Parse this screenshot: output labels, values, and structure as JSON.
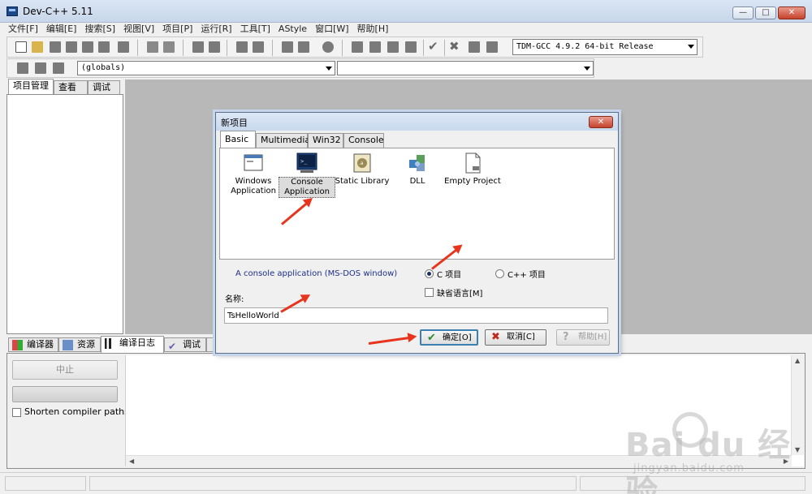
{
  "window": {
    "title": "Dev-C++ 5.11",
    "min_glyph": "—",
    "max_glyph": "□",
    "close_glyph": "✕"
  },
  "menu": [
    "文件[F]",
    "编辑[E]",
    "搜索[S]",
    "视图[V]",
    "项目[P]",
    "运行[R]",
    "工具[T]",
    "AStyle",
    "窗口[W]",
    "帮助[H]"
  ],
  "toolbar": {
    "compiler": "TDM-GCC 4.9.2 64-bit Release",
    "scope": "(globals)",
    "member": ""
  },
  "left_panel": {
    "tabs": [
      "项目管理",
      "查看类",
      "调试"
    ],
    "active_tab": 0
  },
  "bottom_panel": {
    "tabs": [
      "编译器",
      "资源",
      "编译日志",
      "调试"
    ],
    "active_tab": 2,
    "stop_label": "中止",
    "shorten_label": "Shorten compiler paths",
    "shorten_checked": false
  },
  "dialog": {
    "title": "新项目",
    "close_glyph": "✕",
    "tabs": [
      "Basic",
      "Multimedia",
      "Win32",
      "Console"
    ],
    "active_tab": 0,
    "templates": [
      {
        "label1": "Windows",
        "label2": "Application",
        "icon": "window-icon"
      },
      {
        "label1": "Console",
        "label2": "Application",
        "icon": "console-icon",
        "selected": true
      },
      {
        "label1": "Static Library",
        "label2": "",
        "icon": "static-library-icon"
      },
      {
        "label1": "DLL",
        "label2": "",
        "icon": "dll-puzzle-icon"
      },
      {
        "label1": "Empty Project",
        "label2": "",
        "icon": "empty-project-icon"
      }
    ],
    "description": "A console application (MS-DOS window)",
    "c_label": "C 项目",
    "cpp_label": "C++ 项目",
    "language": "C",
    "default_lang_label": "缺省语言[M]",
    "default_lang_checked": false,
    "name_label": "名称:",
    "name_value": "TsHelloWorld",
    "ok_label": "确定[O]",
    "cancel_label": "取消[C]",
    "help_label": "帮助[H]",
    "ok_glyph": "✔",
    "cancel_glyph": "✖",
    "help_glyph": "?"
  },
  "colors": {
    "accent_arrow": "#e8341c",
    "description_text": "#1e2f8a"
  },
  "watermark": {
    "main": "Bai du 经验",
    "sub": "jingyan.baidu.com"
  }
}
